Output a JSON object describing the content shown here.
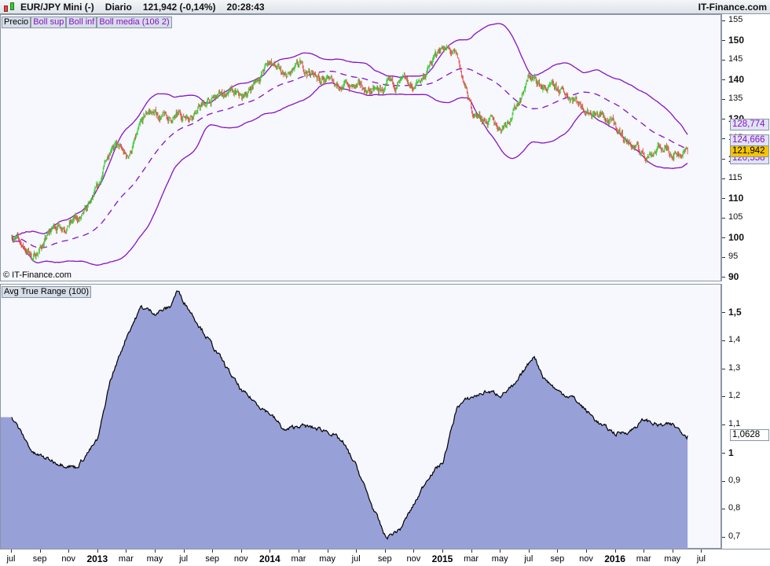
{
  "header": {
    "symbol": "EUR/JPY Mini (-)",
    "period": "Diario",
    "price": "121,942 (-0,14%)",
    "time": "20:28:43",
    "brand": "IT-Finance.com"
  },
  "price_pane": {
    "legend": [
      "Precio",
      "Boll sup",
      "Boll inf",
      "Boll media (106 2)"
    ],
    "copyright": "© IT-Finance.com",
    "y_ticks": [
      "155",
      "150",
      "145",
      "140",
      "135",
      "130",
      "125",
      "120",
      "115",
      "110",
      "105",
      "100",
      "95",
      "90"
    ],
    "tags": {
      "upper": "128,774",
      "middle": "124,666",
      "last": "121,942",
      "lower": "120,558"
    }
  },
  "atr_pane": {
    "legend": "Avg True Range (100)",
    "y_ticks": [
      "1,5",
      "1,4",
      "1,3",
      "1,2",
      "1,1",
      "1",
      "0,9",
      "0,8",
      "0,7"
    ],
    "tag": "1,0628"
  },
  "x_axis": [
    "jul",
    "sep",
    "nov",
    "2013",
    "mar",
    "may",
    "jul",
    "sep",
    "nov",
    "2014",
    "mar",
    "may",
    "jul",
    "sep",
    "nov",
    "2015",
    "mar",
    "may",
    "jul",
    "sep",
    "nov",
    "2016",
    "mar",
    "may",
    "jul"
  ],
  "colors": {
    "up": "#33cc33",
    "down": "#ee4444",
    "band": "#8a10c8",
    "atr_fill": "#98a0d8",
    "last_tag": "#f5c400"
  },
  "chart_data": [
    {
      "type": "line",
      "title": "EUR/JPY Diario",
      "x_unit": "months since Jul 2012",
      "ylim": [
        90,
        155
      ],
      "close_path": [
        [
          0,
          101
        ],
        [
          1.5,
          95
        ],
        [
          3,
          103
        ],
        [
          5,
          105
        ],
        [
          6,
          112
        ],
        [
          7,
          125
        ],
        [
          8,
          120
        ],
        [
          9.5,
          132
        ],
        [
          11,
          130
        ],
        [
          12,
          131
        ],
        [
          13,
          133
        ],
        [
          15,
          137
        ],
        [
          16,
          135
        ],
        [
          18,
          145
        ],
        [
          19,
          140
        ],
        [
          20,
          143
        ],
        [
          22,
          140
        ],
        [
          24,
          138
        ],
        [
          25.5,
          137
        ],
        [
          27,
          139
        ],
        [
          28,
          138
        ],
        [
          29,
          143
        ],
        [
          30,
          149
        ],
        [
          31,
          145
        ],
        [
          32,
          132
        ],
        [
          33,
          130
        ],
        [
          34,
          128
        ],
        [
          35,
          133
        ],
        [
          36,
          141
        ],
        [
          37,
          138
        ],
        [
          38,
          137
        ],
        [
          39,
          136
        ],
        [
          40,
          133
        ],
        [
          41,
          131
        ],
        [
          42,
          128
        ],
        [
          43,
          124
        ],
        [
          44,
          121
        ],
        [
          45,
          123
        ],
        [
          46,
          122
        ],
        [
          47,
          121.942
        ]
      ],
      "bollinger": {
        "period": 106,
        "std": 2,
        "last_upper": 128.774,
        "last_middle": 124.666,
        "last_lower": 120.558
      }
    },
    {
      "type": "area",
      "title": "Avg True Range (100)",
      "x_unit": "months since Jul 2012",
      "ylim": [
        0.65,
        1.55
      ],
      "values": [
        [
          0,
          1.13
        ],
        [
          1.5,
          1.0
        ],
        [
          3,
          0.97
        ],
        [
          4.5,
          0.95
        ],
        [
          6,
          1.05
        ],
        [
          6.8,
          1.25
        ],
        [
          8,
          1.42
        ],
        [
          9,
          1.52
        ],
        [
          10,
          1.5
        ],
        [
          11,
          1.52
        ],
        [
          11.5,
          1.58
        ],
        [
          12.5,
          1.5
        ],
        [
          14,
          1.38
        ],
        [
          16,
          1.22
        ],
        [
          18,
          1.14
        ],
        [
          19,
          1.08
        ],
        [
          20,
          1.1
        ],
        [
          22,
          1.08
        ],
        [
          23,
          1.04
        ],
        [
          24,
          0.95
        ],
        [
          25,
          0.82
        ],
        [
          26,
          0.7
        ],
        [
          27,
          0.73
        ],
        [
          28,
          0.82
        ],
        [
          29,
          0.92
        ],
        [
          30,
          0.97
        ],
        [
          31,
          1.17
        ],
        [
          32,
          1.2
        ],
        [
          33,
          1.22
        ],
        [
          34,
          1.21
        ],
        [
          35,
          1.24
        ],
        [
          36.3,
          1.35
        ],
        [
          37,
          1.27
        ],
        [
          38,
          1.22
        ],
        [
          39,
          1.2
        ],
        [
          40,
          1.15
        ],
        [
          41,
          1.1
        ],
        [
          42,
          1.07
        ],
        [
          43,
          1.08
        ],
        [
          44,
          1.12
        ],
        [
          45,
          1.1
        ],
        [
          46,
          1.1
        ],
        [
          47,
          1.0628
        ]
      ]
    }
  ]
}
